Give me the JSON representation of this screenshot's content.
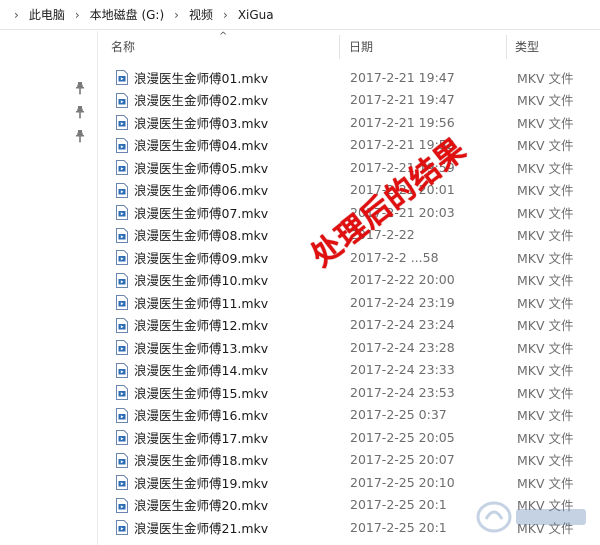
{
  "breadcrumb": {
    "items": [
      "此电脑",
      "本地磁盘 (G:)",
      "视频",
      "XiGua"
    ]
  },
  "columns": {
    "name": "名称",
    "date": "日期",
    "type": "类型"
  },
  "files": [
    {
      "name": "浪漫医生金师傅01.mkv",
      "date": "2017-2-21 19:47",
      "type": "MKV 文件"
    },
    {
      "name": "浪漫医生金师傅02.mkv",
      "date": "2017-2-21 19:47",
      "type": "MKV 文件"
    },
    {
      "name": "浪漫医生金师傅03.mkv",
      "date": "2017-2-21 19:56",
      "type": "MKV 文件"
    },
    {
      "name": "浪漫医生金师傅04.mkv",
      "date": "2017-2-21 19:52",
      "type": "MKV 文件"
    },
    {
      "name": "浪漫医生金师傅05.mkv",
      "date": "2017-2-21 19:59",
      "type": "MKV 文件"
    },
    {
      "name": "浪漫医生金师傅06.mkv",
      "date": "2017-2-21 20:01",
      "type": "MKV 文件"
    },
    {
      "name": "浪漫医生金师傅07.mkv",
      "date": "2017-2-21 20:03",
      "type": "MKV 文件"
    },
    {
      "name": "浪漫医生金师傅08.mkv",
      "date": "2017-2-22",
      "type": "MKV 文件"
    },
    {
      "name": "浪漫医生金师傅09.mkv",
      "date": "2017-2-2 ...58",
      "type": "MKV 文件"
    },
    {
      "name": "浪漫医生金师傅10.mkv",
      "date": "2017-2-22 20:00",
      "type": "MKV 文件"
    },
    {
      "name": "浪漫医生金师傅11.mkv",
      "date": "2017-2-24 23:19",
      "type": "MKV 文件"
    },
    {
      "name": "浪漫医生金师傅12.mkv",
      "date": "2017-2-24 23:24",
      "type": "MKV 文件"
    },
    {
      "name": "浪漫医生金师傅13.mkv",
      "date": "2017-2-24 23:28",
      "type": "MKV 文件"
    },
    {
      "name": "浪漫医生金师傅14.mkv",
      "date": "2017-2-24 23:33",
      "type": "MKV 文件"
    },
    {
      "name": "浪漫医生金师傅15.mkv",
      "date": "2017-2-24 23:53",
      "type": "MKV 文件"
    },
    {
      "name": "浪漫医生金师傅16.mkv",
      "date": "2017-2-25 0:37",
      "type": "MKV 文件"
    },
    {
      "name": "浪漫医生金师傅17.mkv",
      "date": "2017-2-25 20:05",
      "type": "MKV 文件"
    },
    {
      "name": "浪漫医生金师傅18.mkv",
      "date": "2017-2-25 20:07",
      "type": "MKV 文件"
    },
    {
      "name": "浪漫医生金师傅19.mkv",
      "date": "2017-2-25 20:10",
      "type": "MKV 文件"
    },
    {
      "name": "浪漫医生金师傅20.mkv",
      "date": "2017-2-25 20:1",
      "type": "MKV 文件"
    },
    {
      "name": "浪漫医生金师傅21.mkv",
      "date": "2017-2-25 20:1",
      "type": "MKV 文件"
    }
  ],
  "annotation": "处理后的结果",
  "icons": {
    "pin": "pin-icon",
    "file": "video-file-icon",
    "sort": "sort-up-arrow-icon"
  },
  "colors": {
    "annotation": "#e01010",
    "file_icon": "#2b6cb5"
  }
}
